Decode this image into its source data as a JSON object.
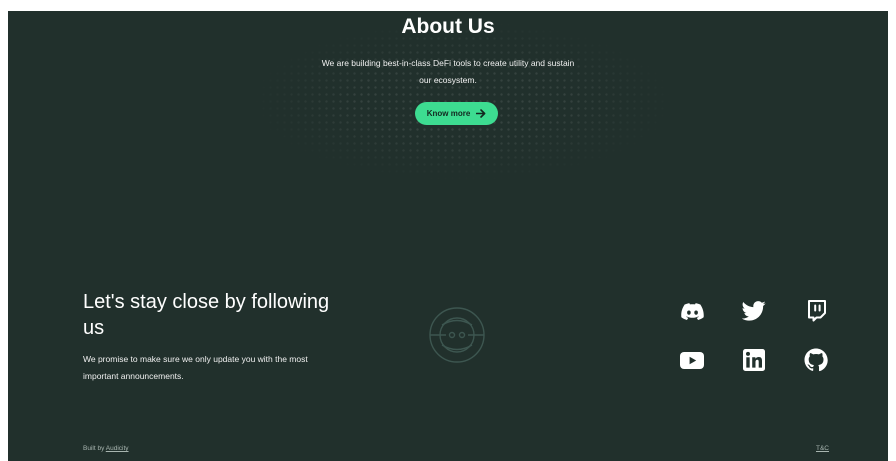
{
  "about": {
    "title": "About Us",
    "text": "We are building best-in-class DeFi tools to create utility and sustain our ecosystem.",
    "button_label": "Know more"
  },
  "follow": {
    "title": "Let's stay close by following us",
    "text": "We promise to make sure we only update you with the most important announcements."
  },
  "social": [
    {
      "name": "discord",
      "icon": "discord-icon"
    },
    {
      "name": "twitter",
      "icon": "twitter-icon"
    },
    {
      "name": "twitch",
      "icon": "twitch-icon"
    },
    {
      "name": "youtube",
      "icon": "youtube-icon"
    },
    {
      "name": "linkedin",
      "icon": "linkedin-icon"
    },
    {
      "name": "github",
      "icon": "github-icon"
    }
  ],
  "footer": {
    "built_prefix": "Built by",
    "built_link": "Audicity",
    "terms": "T&C"
  },
  "colors": {
    "background": "#21302c",
    "accent": "#3ddc91",
    "text": "#ffffff"
  }
}
